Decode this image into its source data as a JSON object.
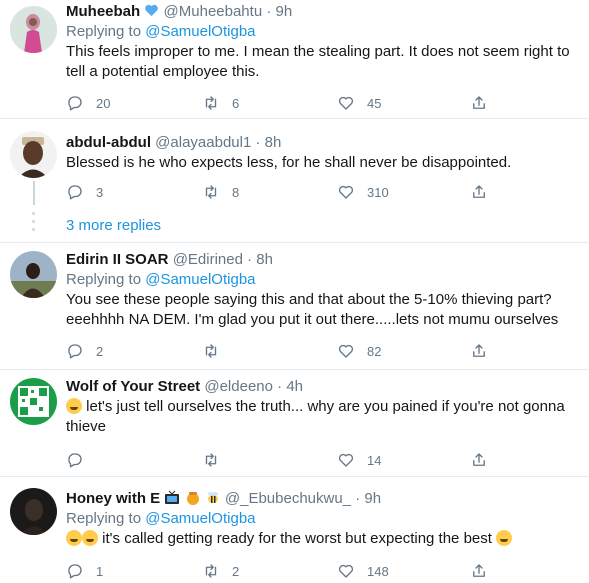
{
  "tweets": [
    {
      "name": "Muheebah",
      "handle": "@Muheebahtu",
      "time": "9h",
      "replying_prefix": "Replying to",
      "replying_to": "@SamuelOtigba",
      "text": "This feels improper to me. I mean the stealing part. It does not seem right to tell a potential employee this.",
      "replies": "20",
      "retweets": "6",
      "likes": "45"
    },
    {
      "name": "abdul-abdul",
      "handle": "@alayaabdul1",
      "time": "8h",
      "text": "Blessed is he who expects less, for he shall never be disappointed.",
      "replies": "3",
      "retweets": "8",
      "likes": "310"
    },
    {
      "name": "Edirin II SOAR",
      "handle": "@Edirined",
      "time": "8h",
      "replying_prefix": "Replying to",
      "replying_to": "@SamuelOtigba",
      "text": "You see these people saying this and that about the 5-10% thieving part? eeehhhh NA DEM. I'm glad you put it out there.....lets not mumu ourselves",
      "replies": "2",
      "retweets": "",
      "likes": "82"
    },
    {
      "name": "Wolf of Your Street",
      "handle": "@eldeeno",
      "time": "4h",
      "text": "let's just tell ourselves the truth... why are you pained if you're not gonna thieve",
      "replies": "",
      "retweets": "",
      "likes": "14"
    },
    {
      "name": "Honey with E",
      "handle": "@_Ebubechukwu_",
      "time": "9h",
      "replying_prefix": "Replying to",
      "replying_to": "@SamuelOtigba",
      "text": "it's called getting ready for the worst but expecting the best",
      "replies": "1",
      "retweets": "2",
      "likes": "148"
    }
  ],
  "more_replies": "3 more replies",
  "separator": "·",
  "colors": {
    "link": "#1b95e0",
    "muted": "#657786",
    "divider": "#e6ecf0"
  }
}
